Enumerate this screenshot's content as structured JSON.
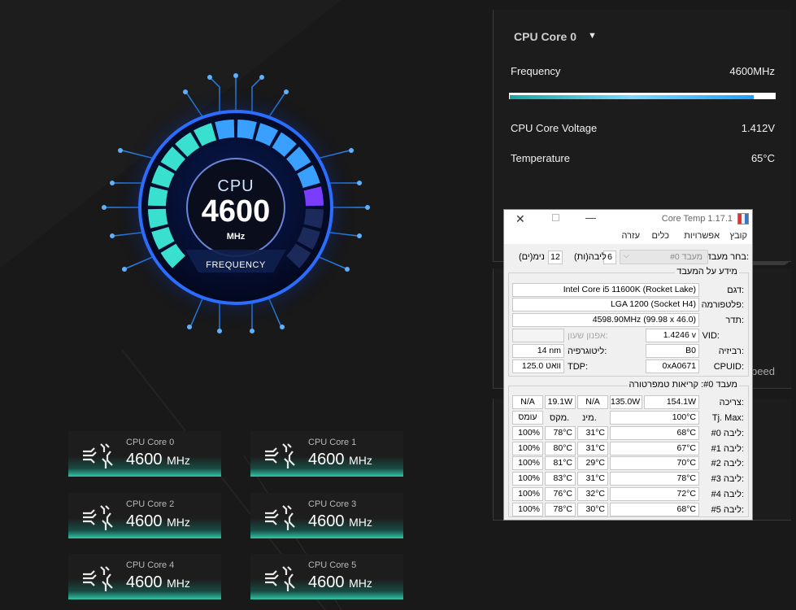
{
  "gauge": {
    "title": "CPU",
    "value": "4600",
    "unit": "MHz",
    "caption": "FREQUENCY",
    "level": 0.85
  },
  "tiles": [
    {
      "label": "CPU Core 0",
      "value": "4600",
      "unit": "MHz"
    },
    {
      "label": "CPU Core 1",
      "value": "4600",
      "unit": "MHz"
    },
    {
      "label": "CPU Core 2",
      "value": "4600",
      "unit": "MHz"
    },
    {
      "label": "CPU Core 3",
      "value": "4600",
      "unit": "MHz"
    },
    {
      "label": "CPU Core 4",
      "value": "4600",
      "unit": "MHz"
    },
    {
      "label": "CPU Core 5",
      "value": "4600",
      "unit": "MHz"
    }
  ],
  "panel": {
    "core_select": "CPU Core 0",
    "frequency_label": "Frequency",
    "frequency_value": "4600MHz",
    "frequency_level": 0.92,
    "voltage_label": "CPU Core Voltage",
    "voltage_value": "1.412V",
    "temperature_label": "Temperature",
    "temperature_value": "65°C"
  },
  "hidden_panel_text": "peed",
  "coretemp": {
    "title": "Core Temp 1.17.1",
    "menu": [
      "קובץ",
      "אפשרויות",
      "כלים",
      "עזרה"
    ],
    "select_label": "בחר מעבד:",
    "select_value": "מעבד #0",
    "cores_value": "6",
    "cores_label": "ליבה(ות)",
    "threads_value": "12",
    "threads_label": "נימ(ים)",
    "info_header": "מידע על המעבד",
    "model_label": "דגם:",
    "model_value": "Intel Core i5 11600K (Rocket Lake)",
    "platform_label": "פלטפורמה:",
    "platform_value": "LGA 1200 (Socket H4)",
    "freq_label": "תדר:",
    "freq_value": "4598.90MHz (99.98 x 46.0)",
    "vid_label": "VID:",
    "vid_value": "1.4246 v",
    "modulation_label": "אפנון שעון:",
    "revision_label": "רביזיה:",
    "revision_value": "B0",
    "litho_label": "ליטוגרפיה:",
    "litho_value": "14 nm",
    "cpuid_label": "CPUID:",
    "cpuid_value": "0xA0671",
    "tdp_label": "TDP:",
    "tdp_value": "125.0 וואט",
    "temps_header": "מעבד #0: קריאות טמפרטורה",
    "power_label": "צריכה:",
    "power_values": [
      "154.1W",
      "135.0W",
      "N/A",
      "19.1W",
      "N/A"
    ],
    "tjmax_label": "Tj. Max:",
    "tjmax_value": "100°C",
    "col_min": "מינ.",
    "col_max": "מקס.",
    "col_load": "עומס",
    "cores": [
      {
        "label": "ליבה #0:",
        "temp": "68°C",
        "min": "31°C",
        "max": "78°C",
        "load": "100%"
      },
      {
        "label": "ליבה #1:",
        "temp": "67°C",
        "min": "31°C",
        "max": "80°C",
        "load": "100%"
      },
      {
        "label": "ליבה #2:",
        "temp": "70°C",
        "min": "29°C",
        "max": "81°C",
        "load": "100%"
      },
      {
        "label": "ליבה #3:",
        "temp": "78°C",
        "min": "31°C",
        "max": "83°C",
        "load": "100%"
      },
      {
        "label": "ליבה #4:",
        "temp": "72°C",
        "min": "32°C",
        "max": "76°C",
        "load": "100%"
      },
      {
        "label": "ליבה #5:",
        "temp": "68°C",
        "min": "30°C",
        "max": "78°C",
        "load": "100%"
      }
    ]
  },
  "colors": {
    "accent_teal": "#2fc6a8",
    "gauge_blue": "#1e6bff",
    "gauge_cyan": "#39e0d0",
    "gauge_violet": "#7a3cff"
  },
  "icons": {
    "tile_icon": "cpu-circuit-icon",
    "caret": "caret-down-icon"
  }
}
